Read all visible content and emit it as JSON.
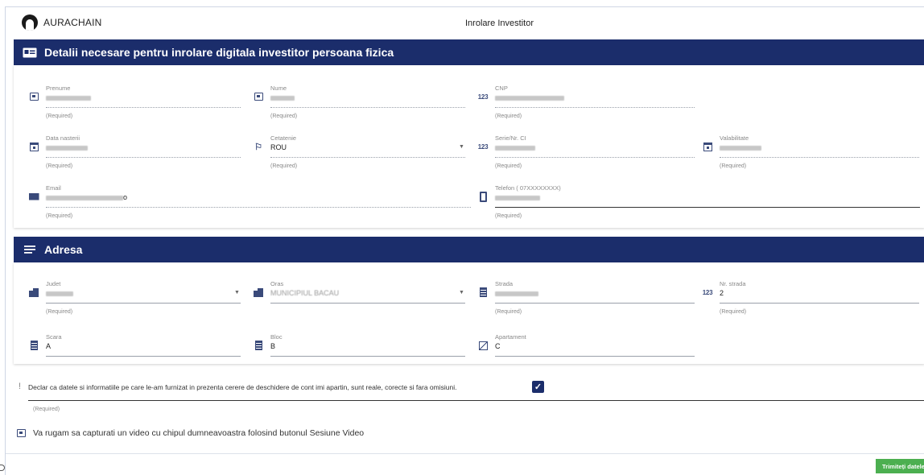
{
  "header": {
    "brand": "AURACHAIN",
    "title": "Inrolare Investitor"
  },
  "section_personal": {
    "title": "Detalii necesare pentru inrolare digitala investitor persoana fizica",
    "fields": {
      "prenume": {
        "label": "Prenume",
        "help": "(Required)"
      },
      "nume": {
        "label": "Nume",
        "help": "(Required)"
      },
      "cnp": {
        "label": "CNP",
        "help": "(Required)"
      },
      "data_nasterii": {
        "label": "Data nasterii",
        "help": "(Required)"
      },
      "cetatenie": {
        "label": "Cetatenie",
        "value": "ROU",
        "help": "(Required)"
      },
      "serie_ci": {
        "label": "Serie/Nr. CI",
        "help": "(Required)"
      },
      "valabilitate": {
        "label": "Valabilitate",
        "help": "(Required)"
      },
      "email": {
        "label": "Email",
        "value_suffix": "o",
        "help": "(Required)"
      },
      "telefon": {
        "label": "Telefon ( 07XXXXXXXX)",
        "help": "(Required)"
      }
    }
  },
  "section_address": {
    "title": "Adresa",
    "fields": {
      "judet": {
        "label": "Judet",
        "help": "(Required)"
      },
      "oras": {
        "label": "Oras",
        "value": "MUNICIPIUL BACAU",
        "help": ""
      },
      "strada": {
        "label": "Strada",
        "help": "(Required)"
      },
      "nr_strada": {
        "label": "Nr. strada",
        "value": "2",
        "help": "(Required)"
      },
      "scara": {
        "label": "Scara",
        "value": "A"
      },
      "bloc": {
        "label": "Bloc",
        "value": "B"
      },
      "apartament": {
        "label": "Apartament",
        "value": "C"
      }
    }
  },
  "declaration": {
    "text": "Declar ca datele si informatiile pe care le-am furnizat in prezenta cerere de deschidere de cont imi apartin, sunt reale, corecte si fara omisiuni.",
    "help": "(Required)",
    "checked": true
  },
  "video_note": {
    "text": "Va rugam sa capturati un video cu chipul dumneavoastra folosind butonul Sesiune Video"
  },
  "actions": {
    "submit_label": "Trimiteți datele"
  },
  "colors": {
    "header_bar": "#1b2d6b",
    "submit": "#4caf50",
    "icon": "#3a4a7a"
  }
}
